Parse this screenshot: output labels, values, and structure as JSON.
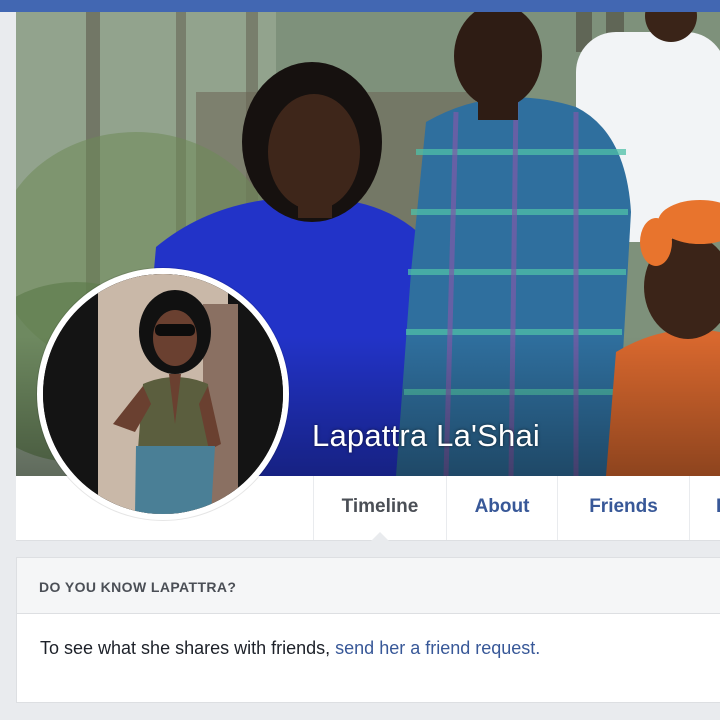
{
  "profile": {
    "name": "Lapattra La'Shai"
  },
  "nav": {
    "tabs": [
      {
        "label": "Timeline",
        "active": true
      },
      {
        "label": "About",
        "active": false
      },
      {
        "label": "Friends",
        "active": false
      },
      {
        "label": "I",
        "active": false
      }
    ]
  },
  "know_card": {
    "header": "DO YOU KNOW LAPATTRA?",
    "body_prefix": "To see what she shares with friends, ",
    "link_text": "send her a friend request."
  },
  "colors": {
    "brand_bar": "#4267b2",
    "link": "#385898",
    "page_bg": "#e9ebee"
  }
}
